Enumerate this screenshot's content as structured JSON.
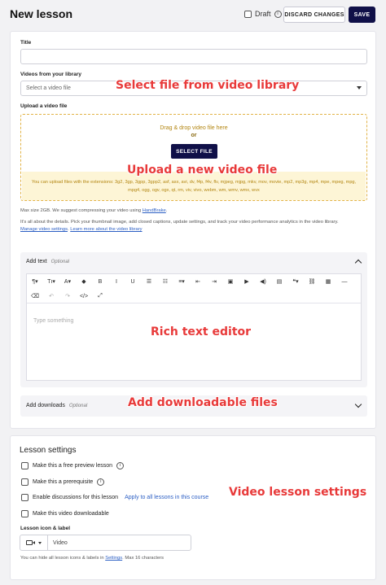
{
  "header": {
    "title": "New lesson",
    "draft_label": "Draft",
    "discard_label": "DISCARD CHANGES",
    "save_label": "SAVE"
  },
  "form": {
    "title_label": "Title",
    "title_value": "",
    "library_label": "Videos from your library",
    "library_placeholder": "Select a video file",
    "upload_label": "Upload a video file",
    "drag_text": "Drag & drop video file here",
    "or_text": "or",
    "select_file_label": "SELECT FILE",
    "extensions_text": "You can upload files with the extensions: 3g2, 3gp, 3gpp, 3gpp2, asf, asx, avi, dv, f4p, f4v, flv, mjpeg, mjpg, mkv, mov, movie, mp2, mp3g, mp4, mpe, mpeg, mpg, mpg4, ogg, ogv, ogx, qt, rm, viv, vivo, webm, wm, wmv, wmx, wvx",
    "max_size_text": "Max size 2GB. We suggest compressing your video using",
    "handbrake_link": "HandBrake",
    "details_text": "It's all about the details. Pick your thumbnail image, add closed captions, update settings, and track your video performance analytics in the video library.",
    "manage_link": "Manage video settings",
    "learn_link": "Learn more about the video library"
  },
  "rich_text": {
    "label": "Add text",
    "optional": "Optional",
    "placeholder": "Type something",
    "toolbar_row1": [
      "¶▾",
      "Tı▾",
      "A▾",
      "◆",
      "B",
      "I",
      "U",
      "☰",
      "☷",
      "≡▾",
      "⇤",
      "⇥",
      "▣",
      "▶",
      "◀)",
      "▤",
      "❝▾",
      "⛓",
      "▦",
      "—"
    ],
    "toolbar_row2": [
      "⌫",
      "↶",
      "↷",
      "</>",
      "⤢"
    ]
  },
  "downloads": {
    "label": "Add downloads",
    "optional": "Optional"
  },
  "lesson_settings": {
    "title": "Lesson settings",
    "options": [
      {
        "label": "Make this a free preview lesson",
        "has_info": true
      },
      {
        "label": "Make this a prerequisite",
        "has_info": true
      },
      {
        "label": "Enable discussions for this lesson",
        "link": "Apply to all lessons in this course"
      },
      {
        "label": "Make this video downloadable"
      }
    ],
    "icon_label_title": "Lesson icon & label",
    "icon_label_value": "Video",
    "hide_note": "You can hide all lesson icons & labels in",
    "settings_link": "Settings",
    "hide_note_suffix": ". Max 16 characters"
  },
  "annotations": {
    "library": "Select file from video library",
    "upload": "Upload a new video file",
    "rich": "Rich text editor",
    "downloads": "Add downloadable files",
    "settings": "Video lesson settings"
  },
  "colors": {
    "primary": "#101048",
    "dropzone_border": "#e2b347",
    "dropzone_text": "#b38612",
    "link": "#2c5fc4",
    "annotation": "#e83a3a"
  }
}
